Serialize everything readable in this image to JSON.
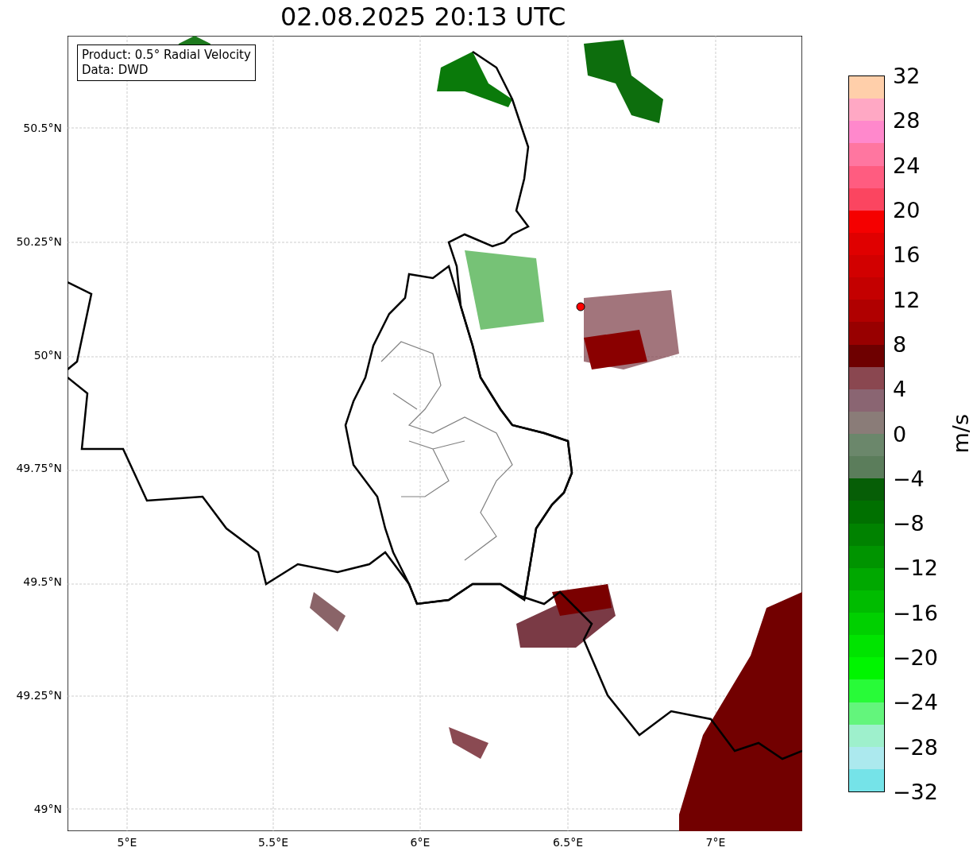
{
  "title": "02.08.2025 20:13 UTC",
  "legend": {
    "lines": [
      "Product: 0.5° Radial Velocity",
      "Data: DWD"
    ]
  },
  "map": {
    "y_ticks": [
      "50.5°N",
      "50.25°N",
      "50°N",
      "49.75°N",
      "49.5°N",
      "49.25°N",
      "49°N"
    ],
    "x_ticks": [
      "5°E",
      "5.5°E",
      "6°E",
      "6.5°E",
      "7°E"
    ]
  },
  "colorbar": {
    "label": "m/s",
    "ticks": [
      "32",
      "28",
      "24",
      "20",
      "16",
      "12",
      "8",
      "4",
      "0",
      "−4",
      "−8",
      "−12",
      "−16",
      "−20",
      "−24",
      "−28",
      "−32"
    ],
    "bins": [
      {
        "color": "#ffcfaa"
      },
      {
        "color": "#ffa8c4"
      },
      {
        "color": "#ff88cc"
      },
      {
        "color": "#ff76a0"
      },
      {
        "color": "#ff5c80"
      },
      {
        "color": "#fb4560"
      },
      {
        "color": "#f50000"
      },
      {
        "color": "#e00000"
      },
      {
        "color": "#d20000"
      },
      {
        "color": "#c40000"
      },
      {
        "color": "#b00000"
      },
      {
        "color": "#980000"
      },
      {
        "color": "#6e0000"
      },
      {
        "color": "#8a4750"
      },
      {
        "color": "#8a6572"
      },
      {
        "color": "#8a7c78"
      },
      {
        "color": "#6b876b"
      },
      {
        "color": "#5b7d5b"
      },
      {
        "color": "#065e06"
      },
      {
        "color": "#007000"
      },
      {
        "color": "#008200"
      },
      {
        "color": "#009400"
      },
      {
        "color": "#00a800"
      },
      {
        "color": "#00bc00"
      },
      {
        "color": "#00d000"
      },
      {
        "color": "#00e400"
      },
      {
        "color": "#00f500"
      },
      {
        "color": "#28fb38"
      },
      {
        "color": "#63f57c"
      },
      {
        "color": "#9ef0cc"
      },
      {
        "color": "#ace9ee"
      },
      {
        "color": "#75e3e8"
      }
    ]
  }
}
